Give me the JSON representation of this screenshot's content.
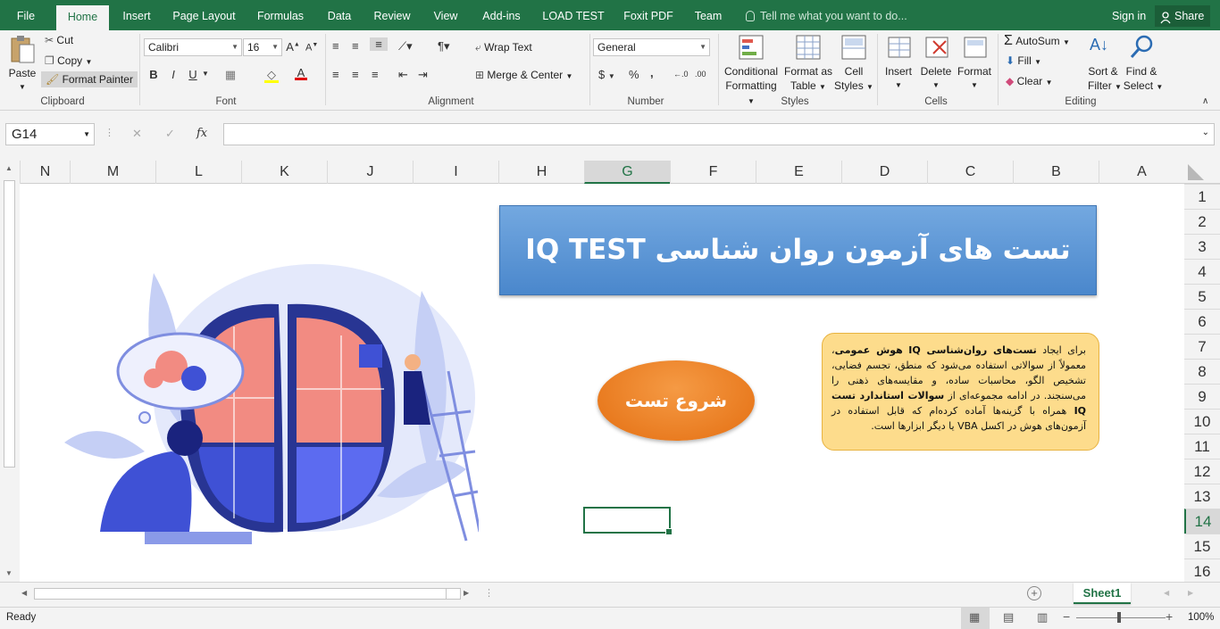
{
  "tabs": {
    "file": "File",
    "home": "Home",
    "insert": "Insert",
    "page_layout": "Page Layout",
    "formulas": "Formulas",
    "data": "Data",
    "review": "Review",
    "view": "View",
    "addins": "Add-ins",
    "load_test": "LOAD TEST",
    "foxit": "Foxit PDF",
    "team": "Team"
  },
  "tell_me": "Tell me what you want to do...",
  "sign_in": "Sign in",
  "share": "Share",
  "clipboard": {
    "paste": "Paste",
    "cut": "Cut",
    "copy": "Copy",
    "format_painter": "Format Painter",
    "label": "Clipboard"
  },
  "font": {
    "name": "Calibri",
    "size": "16",
    "bold": "B",
    "italic": "I",
    "underline": "U",
    "label": "Font"
  },
  "alignment": {
    "wrap_text": "Wrap Text",
    "merge_center": "Merge & Center",
    "label": "Alignment"
  },
  "number": {
    "format": "General",
    "label": "Number",
    "currency": "$",
    "percent": "%",
    "comma": ","
  },
  "styles": {
    "conditional": "Conditional",
    "conditional2": "Formatting",
    "format_table": "Format as",
    "format_table2": "Table",
    "cell_styles": "Cell",
    "cell_styles2": "Styles",
    "label": "Styles"
  },
  "cells": {
    "insert": "Insert",
    "delete": "Delete",
    "format": "Format",
    "label": "Cells"
  },
  "editing": {
    "autosum": "AutoSum",
    "fill": "Fill",
    "clear": "Clear",
    "sort": "Sort &",
    "sort2": "Filter",
    "find": "Find &",
    "find2": "Select",
    "label": "Editing"
  },
  "formula_bar": {
    "name_box": "G14",
    "fx": "fx",
    "value": ""
  },
  "columns": [
    "N",
    "M",
    "L",
    "K",
    "J",
    "I",
    "H",
    "G",
    "F",
    "E",
    "D",
    "C",
    "B",
    "A"
  ],
  "selected_column": "G",
  "rows": [
    "1",
    "2",
    "3",
    "4",
    "5",
    "6",
    "7",
    "8",
    "9",
    "10",
    "11",
    "12",
    "13",
    "14",
    "15",
    "16"
  ],
  "selected_row": "14",
  "banner_title": "تست های آزمون روان شناسی IQ TEST",
  "start_button": "شروع تست",
  "info_text": {
    "p1": "برای ایجاد ",
    "b1": "تست‌های روان‌شناسی IQ",
    "b2": "هوش عمومی",
    "p2": "، معمولاً از سوالاتی استفاده می‌شود که منطق، تجسم فضایی، تشخیص الگو، محاسبات ساده، و مقایسه‌های ذهنی را می‌سنجند. در ادامه مجموعه‌ای از ",
    "b3": "سوالات استاندارد تست IQ",
    "p3": "همراه با گزینه‌ها آماده کرده‌ام که قابل استفاده در آزمون‌های هوش در اکسل VBA یا دیگر ابزارها است."
  },
  "sheet_tab": "Sheet1",
  "status": "Ready",
  "zoom": "100%",
  "colors": {
    "excel_green": "#217346",
    "banner_blue": "#5b96d6",
    "start_orange": "#ee7d22",
    "info_yellow": "#fddc8c"
  }
}
